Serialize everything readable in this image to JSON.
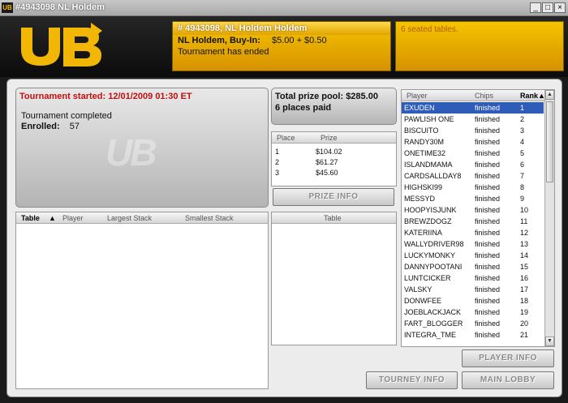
{
  "window": {
    "app_icon_text": "UB",
    "title": "#4943098 NL Holdem",
    "minimize": "_",
    "maximize": "□",
    "close": "×"
  },
  "brand": {
    "logo": "UB",
    "accent": "#f2b705"
  },
  "header": {
    "title": "# 4943098, NL Holdem Holdem",
    "game_label": "NL Holdem, Buy-In:",
    "buyin": "$5.00 + $0.50",
    "status": "Tournament has ended",
    "seated": "6 seated tables."
  },
  "summary": {
    "started_label": "Tournament started:",
    "started_value": "12/01/2009 01:30 ET",
    "status": "Tournament completed",
    "enrolled_label": "Enrolled:",
    "enrolled_value": "57",
    "watermark": "UB"
  },
  "prize": {
    "pool_label": "Total prize pool:",
    "pool_value": "$285.00",
    "places_paid": "6 places paid",
    "columns": [
      "Place",
      "Prize"
    ],
    "rows": [
      {
        "place": "1",
        "prize": "$104.02"
      },
      {
        "place": "2",
        "prize": "$61.27"
      },
      {
        "place": "3",
        "prize": "$45.60"
      }
    ],
    "button": "PRIZE INFO"
  },
  "tables": {
    "columns": [
      "Table",
      "Player",
      "Largest Stack",
      "Smallest Stack"
    ],
    "sort_indicator": "▲"
  },
  "table_players": {
    "column": "Table"
  },
  "players": {
    "columns": [
      "Player",
      "Chips",
      "Rank"
    ],
    "sort_indicator": "▲",
    "rows": [
      {
        "name": "EXUDEN",
        "chips": "finished",
        "rank": "1"
      },
      {
        "name": "PAWLISH ONE",
        "chips": "finished",
        "rank": "2"
      },
      {
        "name": "BISCUITO",
        "chips": "finished",
        "rank": "3"
      },
      {
        "name": "RANDY30M",
        "chips": "finished",
        "rank": "4"
      },
      {
        "name": "ONETIME32",
        "chips": "finished",
        "rank": "5"
      },
      {
        "name": "ISLANDMAMA",
        "chips": "finished",
        "rank": "6"
      },
      {
        "name": "CARDSALLDAY8",
        "chips": "finished",
        "rank": "7"
      },
      {
        "name": "HIGHSKI99",
        "chips": "finished",
        "rank": "8"
      },
      {
        "name": "MESSYD",
        "chips": "finished",
        "rank": "9"
      },
      {
        "name": "HOOPYISJUNK",
        "chips": "finished",
        "rank": "10"
      },
      {
        "name": "BREWZDOGZ",
        "chips": "finished",
        "rank": "11"
      },
      {
        "name": "KATERIINA",
        "chips": "finished",
        "rank": "12"
      },
      {
        "name": "WALLYDRIVER98",
        "chips": "finished",
        "rank": "13"
      },
      {
        "name": "LUCKYMONKY",
        "chips": "finished",
        "rank": "14"
      },
      {
        "name": "DANNYPOOTANI",
        "chips": "finished",
        "rank": "15"
      },
      {
        "name": "LUNTCICKER",
        "chips": "finished",
        "rank": "16"
      },
      {
        "name": "VALSKY",
        "chips": "finished",
        "rank": "17"
      },
      {
        "name": "DONWFEE",
        "chips": "finished",
        "rank": "18"
      },
      {
        "name": "JOEBLACKJACK",
        "chips": "finished",
        "rank": "19"
      },
      {
        "name": "FART_BLOGGER",
        "chips": "finished",
        "rank": "20"
      },
      {
        "name": "INTEGRA_TME",
        "chips": "finished",
        "rank": "21"
      }
    ],
    "scroll_up": "▲",
    "scroll_down": "▼"
  },
  "buttons": {
    "player_info": "PLAYER INFO",
    "tourney_info": "TOURNEY INFO",
    "main_lobby": "MAIN LOBBY"
  }
}
